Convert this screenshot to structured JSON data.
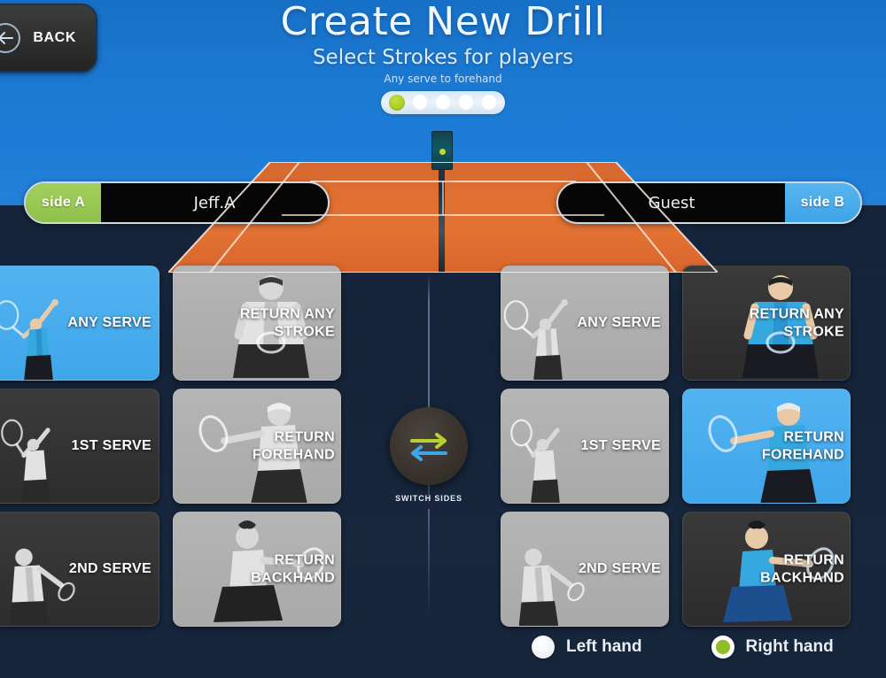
{
  "header": {
    "back_label": "BACK",
    "back_icon": "arrow-left-icon",
    "title": "Create New Drill",
    "subtitle": "Select Strokes for players",
    "hint": "Any serve to forehand",
    "steps": {
      "total": 5,
      "active_index": 0
    }
  },
  "court": {
    "side_a": {
      "tag": "side A",
      "player": "Jeff.A",
      "tag_color": "#8ec24a"
    },
    "side_b": {
      "tag": "side B",
      "player": "Guest",
      "tag_color": "#3ea5e8"
    }
  },
  "left_panel": {
    "cards": [
      {
        "label": "ANY SERVE",
        "state": "selected",
        "figure": "serve-toss"
      },
      {
        "label": "RETURN ANY STROKE",
        "state": "available",
        "figure": "ready-stance"
      },
      {
        "label": "1ST SERVE",
        "state": "dark",
        "figure": "serve-reach"
      },
      {
        "label": "RETURN FOREHAND",
        "state": "available",
        "figure": "forehand"
      },
      {
        "label": "2ND SERVE",
        "state": "dark",
        "figure": "serve-follow"
      },
      {
        "label": "RETURN BACKHAND",
        "state": "available",
        "figure": "backhand"
      }
    ]
  },
  "right_panel": {
    "cards": [
      {
        "label": "ANY SERVE",
        "state": "available",
        "figure": "serve-toss"
      },
      {
        "label": "RETURN ANY STROKE",
        "state": "selected-dark",
        "figure": "ready-stance"
      },
      {
        "label": "1ST SERVE",
        "state": "available",
        "figure": "serve-reach"
      },
      {
        "label": "RETURN FOREHAND",
        "state": "selected",
        "figure": "forehand"
      },
      {
        "label": "2ND SERVE",
        "state": "available",
        "figure": "serve-follow"
      },
      {
        "label": "RETURN BACKHAND",
        "state": "selected-dark",
        "figure": "backhand"
      }
    ]
  },
  "switch_sides": {
    "label": "SWITCH SIDES",
    "icon": "swap-arrows-icon",
    "arrow_right_color": "#b8d130",
    "arrow_left_color": "#3ea5e8"
  },
  "hand_selector": {
    "options": [
      {
        "label": "Left hand",
        "selected": false
      },
      {
        "label": "Right hand",
        "selected": true
      }
    ],
    "selected_color": "#8fbe2a"
  },
  "colors": {
    "accent_blue": "#3ea5e8",
    "accent_green": "#8ec24a",
    "sky": "#1d7cd6",
    "panel_dark": "#15243a",
    "court": "#e0702f"
  }
}
